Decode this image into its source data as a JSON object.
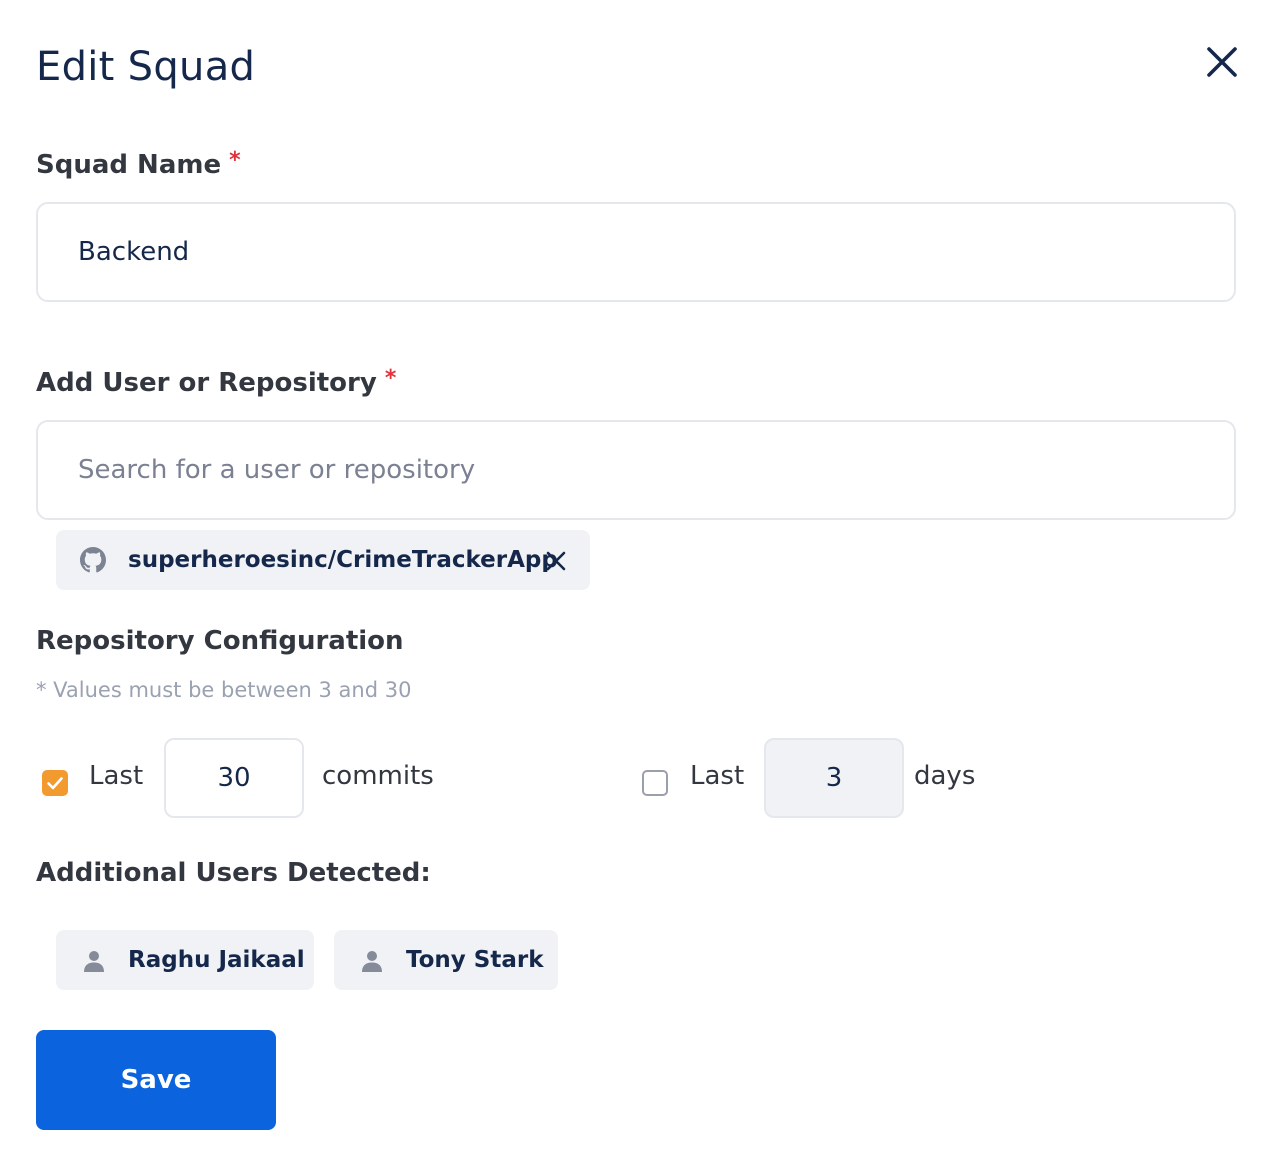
{
  "dialog": {
    "title": "Edit Squad"
  },
  "squad_name": {
    "label": "Squad Name",
    "required_mark": "*",
    "value": "Backend"
  },
  "add_user": {
    "label": "Add User or Repository",
    "required_mark": "*",
    "placeholder": "Search for a user or repository",
    "selected": [
      {
        "label": "superheroesinc/CrimeTrackerApp",
        "icon": "github-icon"
      }
    ]
  },
  "repo_config": {
    "heading": "Repository Configuration",
    "hint": "* Values must be between 3 and 30",
    "commits": {
      "checked": true,
      "prefix": "Last",
      "value": "30",
      "suffix": "commits"
    },
    "days": {
      "checked": false,
      "prefix": "Last",
      "value": "3",
      "suffix": "days"
    }
  },
  "additional_users": {
    "heading": "Additional Users Detected:",
    "users": [
      {
        "name": "Raghu Jaikaal",
        "icon": "user-icon"
      },
      {
        "name": "Tony Stark",
        "icon": "user-icon"
      }
    ]
  },
  "actions": {
    "save_label": "Save"
  },
  "colors": {
    "accent": "#0b64dd",
    "checkbox_checked": "#f39a2e",
    "required": "#e0323a",
    "title": "#15284b"
  }
}
